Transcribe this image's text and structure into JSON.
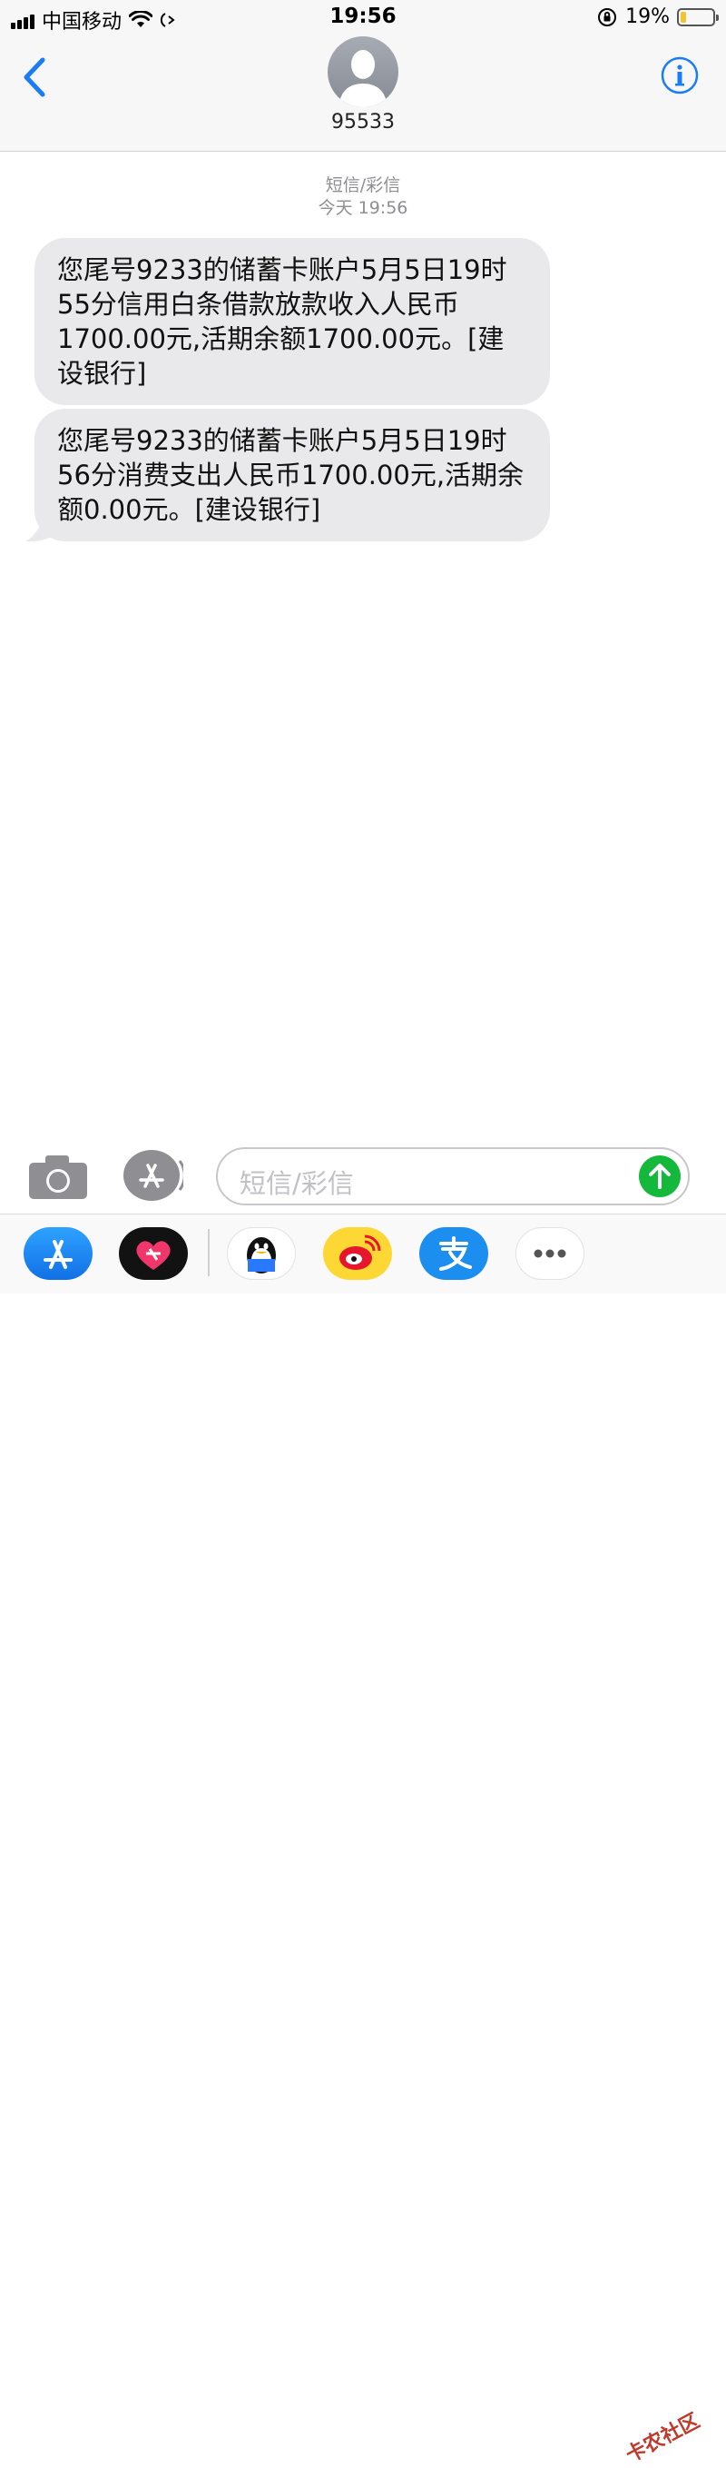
{
  "status_bar": {
    "carrier": "中国移动",
    "time": "19:56",
    "battery_percent_label": "19%",
    "battery_level": 0.19,
    "battery_color": "#f4c430"
  },
  "header": {
    "contact_name": "95533",
    "back_icon": "chevron-left-icon",
    "info_icon": "info-icon",
    "accent_color": "#1a7cf7"
  },
  "conversation": {
    "service_label": "短信/彩信",
    "timestamp": "今天 19:56",
    "messages": [
      {
        "text": "您尾号9233的储蓄卡账户5月5日19时55分信用白条借款放款收入人民币1700.00元,活期余额1700.00元。[建设银行]"
      },
      {
        "text": "您尾号9233的储蓄卡账户5月5日19时56分消费支出人民币1700.00元,活期余额0.00元。[建设银行]"
      }
    ]
  },
  "composer": {
    "placeholder": "短信/彩信",
    "camera_icon": "camera-icon",
    "apps_icon": "app-store-icon",
    "send_icon": "send-arrow-icon",
    "send_color": "#14b83a"
  },
  "app_drawer": {
    "apps": [
      {
        "icon": "app-store-icon"
      },
      {
        "icon": "digital-touch-heart-icon"
      },
      {
        "icon": "qq-penguin-icon"
      },
      {
        "icon": "weibo-icon"
      },
      {
        "icon": "alipay-icon"
      },
      {
        "icon": "more-dots-icon"
      }
    ]
  },
  "watermark": "卡农社区"
}
